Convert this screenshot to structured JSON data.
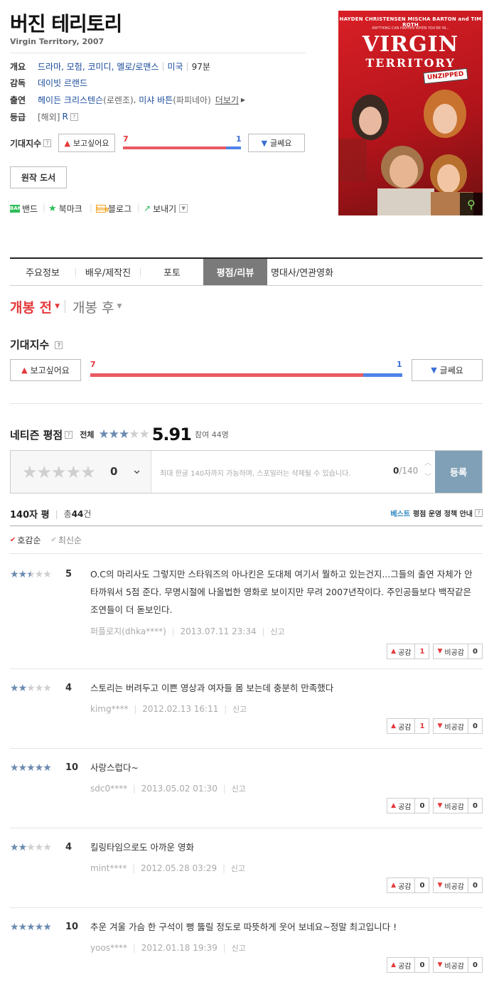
{
  "movie": {
    "title_ko": "버진 테리토리",
    "title_en": "Virgin Territory, 2007",
    "info": {
      "overview_label": "개요",
      "genres": "드라마, 모험, 코미디, 멜로/로맨스",
      "country": "미국",
      "runtime": "97분",
      "director_label": "감독",
      "director": "데이빗 르랜드",
      "cast_label": "출연",
      "cast1": "헤이든 크리스텐슨",
      "cast1_role": "(로렌조)",
      "cast2": "미샤 바튼",
      "cast2_role": "(파피네아)",
      "more": "더보기",
      "rating_label": "등급",
      "rating_region": "[해외]",
      "rating": "R"
    },
    "expect": {
      "label": "기대지수",
      "want_label": "보고싶어요",
      "nah_label": "글쎄요",
      "want_count": "7",
      "nah_count": "1",
      "want_ratio": 0.875
    },
    "original_book": "원작 도서",
    "share": {
      "band_icon": "BAND",
      "band": "밴드",
      "bookmark": "북마크",
      "blog_icon": "blog",
      "blog": "블로그",
      "send": "보내기"
    },
    "poster": {
      "cast_line": "HAYDEN CHRISTENSEN   MISCHA BARTON and TIM ROTH",
      "tagline": "ANYTHING CAN HAPPEN WHEN YOU'RE IN...",
      "title_line1": "VIRGIN",
      "title_line2": "TERRITORY",
      "badge": "UNZIPPED"
    }
  },
  "tabs": [
    "주요정보",
    "배우/제작진",
    "포토",
    "평점/리뷰",
    "명대사/연관영화"
  ],
  "active_tab": 3,
  "release": {
    "before": "개봉 전",
    "after": "개봉 후"
  },
  "expect_section": {
    "title": "기대지수",
    "want_label": "보고싶어요",
    "nah_label": "글쎄요",
    "want_count": "7",
    "nah_count": "1",
    "want_ratio": 0.875
  },
  "netizen": {
    "title": "네티즌 평점",
    "all_label": "전체",
    "score": "5.91",
    "star_fill": 0.59,
    "participants": "참여 44명"
  },
  "input_box": {
    "score": "0",
    "placeholder": "최대 한글 140자까지 가능하며, 스포일러는 삭제될 수 있습니다.",
    "count_current": "0",
    "count_max": "/140",
    "submit": "등록"
  },
  "review_header": {
    "title": "140자 평",
    "total_prefix": "총",
    "total_count": "44",
    "total_suffix": "건",
    "best_label": "베스트",
    "policy": "평점 운영 정책 안내"
  },
  "sort": {
    "sympathy": "호감순",
    "latest": "최신순"
  },
  "vote_labels": {
    "up": "공감",
    "down": "비공감"
  },
  "reviews": [
    {
      "stars": 2.5,
      "score": "5",
      "text": "O.C의 마리사도 그렇지만 스타워즈의 아나킨은 도대체 여기서 뭘하고 있는건지...그들의 출연 자체가 안타까워서 5점 준다. 무명시절에 나올법한 영화로 보이지만 무려 2007년작이다. 주인공들보다 백작같은 조연들이 더 돋보인다.",
      "user": "퍼플로지(dhka****)",
      "date": "2013.07.11 23:34",
      "report": "신고",
      "up": "1",
      "down": "0"
    },
    {
      "stars": 2,
      "score": "4",
      "text": "스토리는 버려두고 이쁜 영상과 여자들 몸 보는데 충분히 만족했다",
      "user": "kimg****",
      "date": "2012.02.13 16:11",
      "report": "신고",
      "up": "1",
      "down": "0"
    },
    {
      "stars": 5,
      "score": "10",
      "text": "사랑스럽다~",
      "user": "sdc0****",
      "date": "2013.05.02 01:30",
      "report": "신고",
      "up": "0",
      "down": "0"
    },
    {
      "stars": 2,
      "score": "4",
      "text": "킬링타임으로도 아까운 영화",
      "user": "mint****",
      "date": "2012.05.28 03:29",
      "report": "신고",
      "up": "0",
      "down": "0"
    },
    {
      "stars": 5,
      "score": "10",
      "text": "추운 겨울 가슴 한 구석이 뻥 뚫릴 정도로 따뜻하게 웃어 보네요~정말 최고입니다 !",
      "user": "yoos****",
      "date": "2012.01.18 19:39",
      "report": "신고",
      "up": "0",
      "down": "0"
    }
  ]
}
